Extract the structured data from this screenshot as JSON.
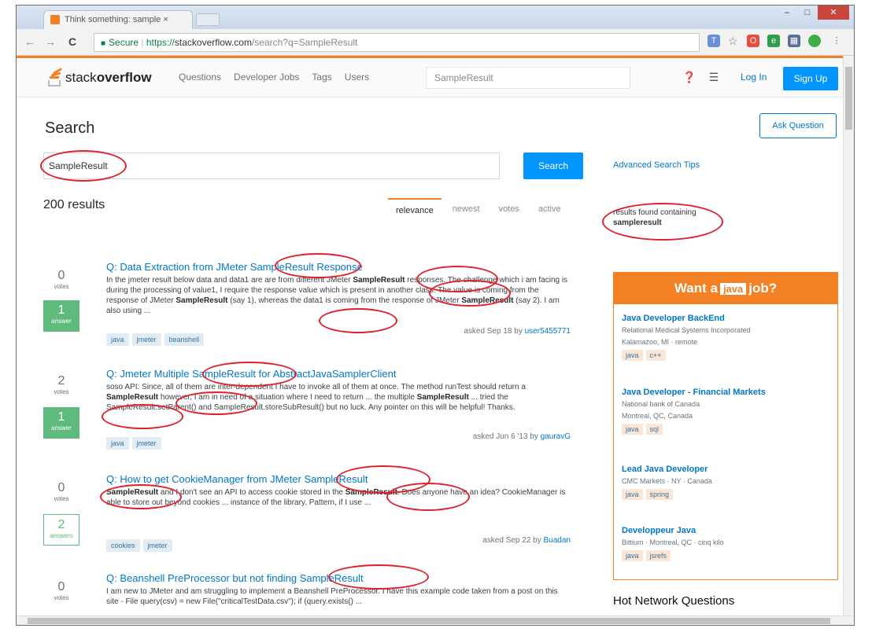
{
  "browser": {
    "tab_title": "Think something: sample ×",
    "tab_close": "×",
    "window_buttons": [
      "–",
      "□",
      "✕"
    ],
    "back": "←",
    "forward": "→",
    "reload": "C",
    "secure_label": "Secure",
    "url_scheme": "https://",
    "url_host": "stackoverflow.com",
    "url_path": "/search?q=SampleResult"
  },
  "header": {
    "logo_text_light": "stack",
    "logo_text_bold": "overflow",
    "nav": [
      "Questions",
      "Developer Jobs",
      "Tags",
      "Users"
    ],
    "search_value": "SampleResult",
    "login": "Log In",
    "signup": "Sign Up"
  },
  "search": {
    "heading": "Search",
    "ask_button": "Ask Question",
    "query": "SampleResult",
    "button": "Search",
    "advanced_link": "Advanced Search Tips",
    "result_count": "200 results",
    "sort_tabs": [
      "relevance",
      "newest",
      "votes",
      "active"
    ],
    "found_note_line1": "results found containing",
    "found_note_term": "sampleresult"
  },
  "questions": [
    {
      "votes": "0",
      "votes_label": "votes",
      "answers": "1",
      "answers_label": "answer",
      "title_pre": "Q: Data Extraction from JMeter ",
      "title_hl": "SampleResult",
      "title_post": " Response",
      "excerpt_1": "In the jmeter result below data and data1 are are from different JMeter ",
      "excerpt_hl1": "SampleResult",
      "excerpt_2": " responses. The challenge which i am facing is during the processing of value1, I require the response value which is present in another class. The value is coming from the response of JMeter ",
      "excerpt_hl2": "SampleResult",
      "excerpt_3": " (say 1), whereas the data1 is coming from the response of JMeter ",
      "excerpt_hl3": "SampleResult",
      "excerpt_4": " (say 2). I am also using ...",
      "tags": [
        "java",
        "jmeter",
        "beanshell"
      ],
      "asked": "asked Sep 18 by",
      "user": "user5455771"
    },
    {
      "votes": "2",
      "votes_label": "votes",
      "answers": "1",
      "answers_label": "answer",
      "title_pre": "Q: Jmeter Multiple ",
      "title_hl": "SampleResult",
      "title_post": " for AbstractJavaSamplerClient",
      "excerpt_1": "soso API: Since, all of them are inter-dependent I have to invoke all of them at once. The method runTest should return a ",
      "excerpt_hl1": "SampleResult",
      "excerpt_2": " however, I am in need of a situation where I need to return ... the multiple ",
      "excerpt_hl2": "SampleResult",
      "excerpt_3": " ... tried the SampleResult.setParent() and SampleResult.storeSubResult() but no luck. Any pointer on this will be helpful! Thanks.",
      "tags": [
        "java",
        "jmeter"
      ],
      "asked": "asked Jun 6 '13 by",
      "user": "gauravG"
    },
    {
      "votes": "0",
      "votes_label": "votes",
      "answers": "2",
      "answers_label": "answers",
      "title_pre": "Q: How to get CookieManager from JMeter ",
      "title_hl": "SampleResult",
      "title_post": "",
      "excerpt_hl1": "SampleResult",
      "excerpt_1": " and I don't see an API to access cookie stored in the ",
      "excerpt_hl2": "SampleResult",
      "excerpt_2": ". Does anyone have an idea? CookieManager is able to store out beyond cookies ... instance of the library. Pattern, if I use ...",
      "tags": [
        "cookies",
        "jmeter"
      ],
      "asked": "asked Sep 22 by",
      "user": "Buadan"
    },
    {
      "votes": "0",
      "votes_label": "votes",
      "title_pre": "Q: Beanshell PreProcessor but not finding ",
      "title_hl": "SampleResult",
      "title_post": "",
      "excerpt_1": "I am new to JMeter and am struggling to implement a Beanshell PreProcessor. I have this example code taken from a post on this site - File query(csv) = new File(\"criticalTestData.csv\"); if (query.exists() ..."
    }
  ],
  "jobs": {
    "head_pre": "Want a",
    "head_hl": "java",
    "head_post": "job?",
    "items": [
      {
        "title": "Java Developer BackEnd",
        "company": "Relational Medical Systems Incorporated",
        "location": "Kalamazoo, MI · remote",
        "tags": [
          "java",
          "c++"
        ]
      },
      {
        "title": "Java Developer - Financial Markets",
        "company": "National bank of Canada",
        "location": "Montreal, QC, Canada",
        "tags": [
          "java",
          "sql"
        ]
      },
      {
        "title": "Lead Java Developer",
        "company": "CMC Markets · NY · Canada",
        "location": "",
        "tags": [
          "java",
          "spring"
        ]
      },
      {
        "title": "Developpeur Java",
        "company": "Bittium · Montreal, QC · cinq kilo",
        "location": "",
        "tags": [
          "java",
          "jsrefs"
        ]
      }
    ]
  },
  "hot_network": "Hot Network Questions",
  "colors": {
    "accent": "#f48024",
    "link": "#0077cc",
    "primary_button": "#0095ff",
    "answered": "#5fba7d",
    "annotation": "#e0202b"
  }
}
